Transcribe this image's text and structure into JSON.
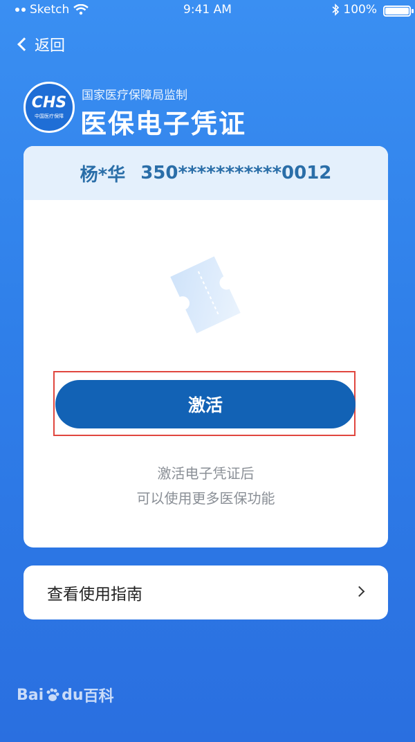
{
  "status_bar": {
    "carrier": "Sketch",
    "time": "9:41 AM",
    "battery": "100%",
    "battery_level": 1.0
  },
  "nav": {
    "back_label": "返回"
  },
  "header": {
    "logo_text": "CHS",
    "logo_sub": "中国医疗保障",
    "subtitle": "国家医疗保障局监制",
    "title": "医保电子凭证"
  },
  "card": {
    "name": "杨*华",
    "id_number": "350***********0012",
    "activate_label": "激活",
    "hint_line1": "激活电子凭证后",
    "hint_line2": "可以使用更多医保功能"
  },
  "guide": {
    "label": "查看使用指南"
  },
  "watermark": {
    "text_a": "Bai",
    "text_b": "du",
    "text_c": "百科"
  },
  "colors": {
    "primary_button": "#1262b5",
    "highlight_outline": "#e0463e",
    "background": "#2f7fe9"
  }
}
